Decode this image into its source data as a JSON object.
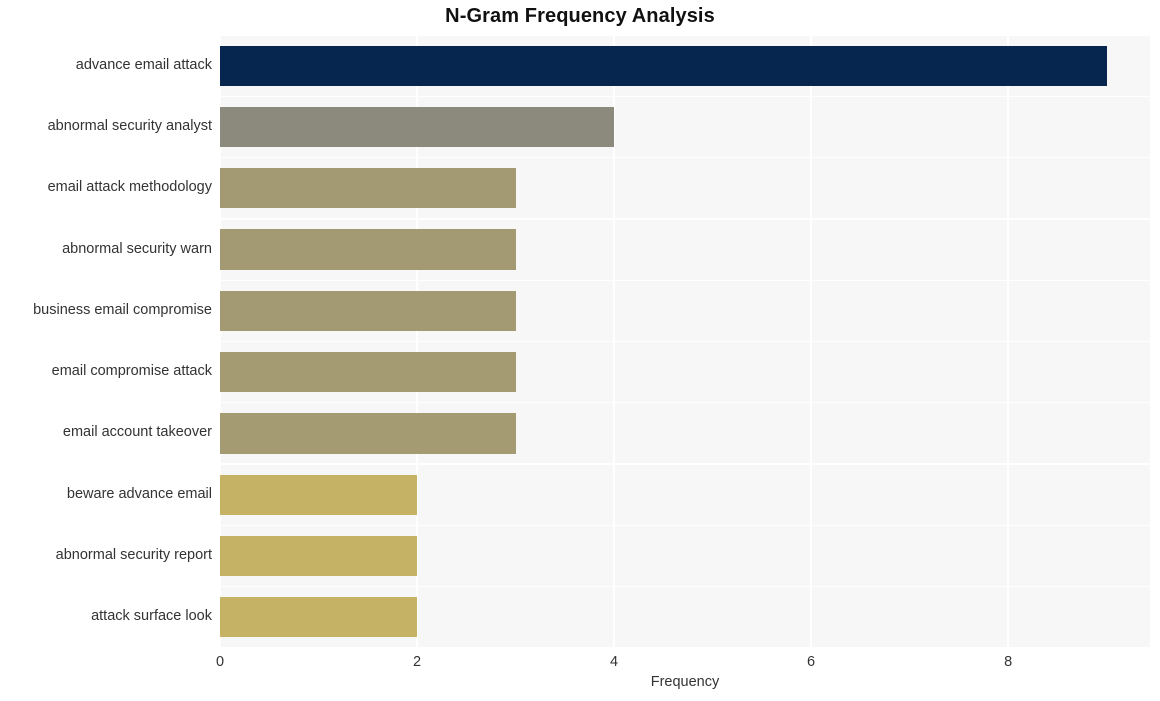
{
  "chart_data": {
    "type": "bar",
    "orientation": "horizontal",
    "title": "N-Gram Frequency Analysis",
    "xlabel": "Frequency",
    "ylabel": "",
    "xlim": [
      0,
      9.44
    ],
    "xticks": [
      0,
      2,
      4,
      6,
      8
    ],
    "xtick_labels": [
      "0",
      "2",
      "4",
      "6",
      "8"
    ],
    "grid": true,
    "legend": null,
    "categories": [
      "advance email attack",
      "abnormal security analyst",
      "email attack methodology",
      "abnormal security warn",
      "business email compromise",
      "email compromise attack",
      "email account takeover",
      "beware advance email",
      "abnormal security report",
      "attack surface look"
    ],
    "values": [
      9,
      4,
      3,
      3,
      3,
      3,
      3,
      2,
      2,
      2
    ],
    "bar_colors": [
      "#06254f",
      "#8b8a7c",
      "#a39a73",
      "#a39a73",
      "#a39a73",
      "#a49b72",
      "#a49b72",
      "#c5b265",
      "#c5b265",
      "#c5b265"
    ],
    "plot_background": "#f7f7f7",
    "gridline_color": "#ffffff",
    "figure_background": "#ffffff",
    "text_color": "#333333",
    "title_color": "#111111"
  }
}
